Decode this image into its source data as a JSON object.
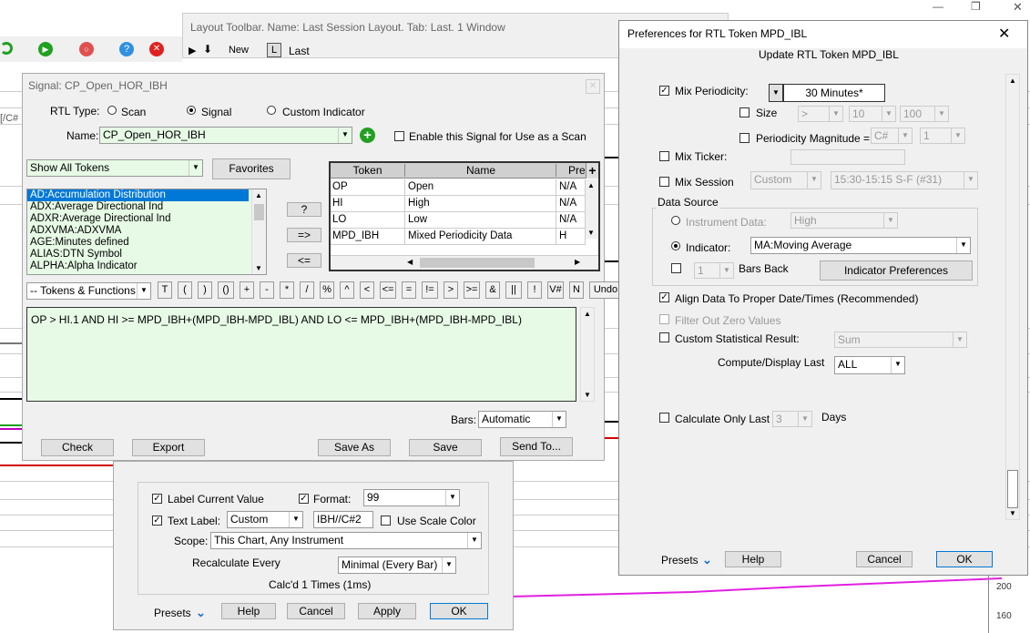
{
  "layout_toolbar": {
    "title": "Layout Toolbar.  Name: Last Session Layout.  Tab: Last.  1 Window",
    "new_label": "New",
    "l_label": "L",
    "last_label": "Last"
  },
  "partial_left": "[/C#",
  "chart_axis": {
    "tick_200": "200",
    "tick_160": "160"
  },
  "signal": {
    "title": "Signal: CP_Open_HOR_IBH",
    "rtl_type_label": "RTL Type:",
    "type_scan": "Scan",
    "type_signal": "Signal",
    "type_custom": "Custom Indicator",
    "name_label": "Name:",
    "name_value": "CP_Open_HOR_IBH",
    "enable_label": "Enable this Signal for Use as a Scan",
    "show_tokens": "Show All Tokens",
    "favorites": "Favorites",
    "token_list": [
      "AD:Accumulation Distribution",
      "ADX:Average Directional Ind",
      "ADXR:Average Directional Ind",
      "ADXVMA:ADXVMA",
      "AGE:Minutes defined",
      "ALIAS:DTN Symbol",
      "ALPHA:Alpha Indicator"
    ],
    "btn_q": "?",
    "btn_add": "=>",
    "btn_remove": "<=",
    "table_headers": [
      "Token",
      "Name",
      "Pre"
    ],
    "table_rows": [
      [
        "OP",
        "Open",
        "N/A"
      ],
      [
        "HI",
        "High",
        "N/A"
      ],
      [
        "LO",
        "Low",
        "N/A"
      ],
      [
        "MPD_IBH",
        "Mixed Periodicity Data",
        "H"
      ]
    ],
    "tokens_functions": "-- Tokens & Functions --",
    "ops": [
      "T",
      "(",
      ")",
      "()",
      "+",
      "-",
      "*",
      "/",
      "%",
      "^",
      "<",
      "<=",
      "=",
      "!=",
      ">",
      ">=",
      "&",
      "||",
      "!",
      "V#",
      "N",
      "Undo"
    ],
    "formula": "OP > HI.1 AND HI >= MPD_IBH+(MPD_IBH-MPD_IBL) AND LO <= MPD_IBH+(MPD_IBH-MPD_IBL)",
    "bars_label": "Bars:",
    "bars_value": "Automatic",
    "check": "Check",
    "export": "Export",
    "save_as": "Save As",
    "save": "Save",
    "send_to": "Send To..."
  },
  "label_dialog": {
    "label_current": "Label Current Value",
    "format_label": "Format:",
    "format_value": "99",
    "text_label": "Text Label:",
    "text_label_sel": "Custom",
    "text_label_value": "IBH//C#2",
    "use_scale": "Use Scale Color",
    "scope_label": "Scope:",
    "scope_value": "This Chart, Any Instrument",
    "recalc_label": "Recalculate Every",
    "recalc_value": "Minimal (Every Bar)",
    "calcd": "Calc'd 1 Times (1ms)",
    "presets": "Presets",
    "help": "Help",
    "cancel": "Cancel",
    "apply": "Apply",
    "ok": "OK"
  },
  "prefs": {
    "title": "Preferences for RTL Token MPD_IBL",
    "subtitle": "Update RTL Token MPD_IBL",
    "mix_periodicity": "Mix Periodicity:",
    "periodicity_value": "30 Minutes*",
    "size": "Size",
    "size_op": ">",
    "size_a": "10",
    "size_b": "100",
    "period_mag": "Periodicity Magnitude =",
    "mag_a": "C#",
    "mag_b": "1",
    "mix_ticker": "Mix Ticker:",
    "mix_session": "Mix Session",
    "session_type": "Custom",
    "session_value": "15:30-15:15 S-F (#31)",
    "data_source": "Data Source",
    "instrument_data": "Instrument Data:",
    "instrument_value": "High",
    "indicator": "Indicator:",
    "indicator_value": "MA:Moving Average",
    "bars_back_value": "1",
    "bars_back": "Bars Back",
    "indicator_prefs": "Indicator Preferences",
    "align": "Align Data To Proper Date/Times (Recommended)",
    "filter_zero": "Filter Out Zero Values",
    "custom_stat": "Custom Statistical Result:",
    "custom_stat_value": "Sum",
    "compute_last": "Compute/Display Last",
    "compute_value": "ALL",
    "calc_only": "Calculate Only Last",
    "calc_days_value": "3",
    "days": "Days",
    "presets": "Presets",
    "help": "Help",
    "cancel": "Cancel",
    "ok": "OK"
  }
}
